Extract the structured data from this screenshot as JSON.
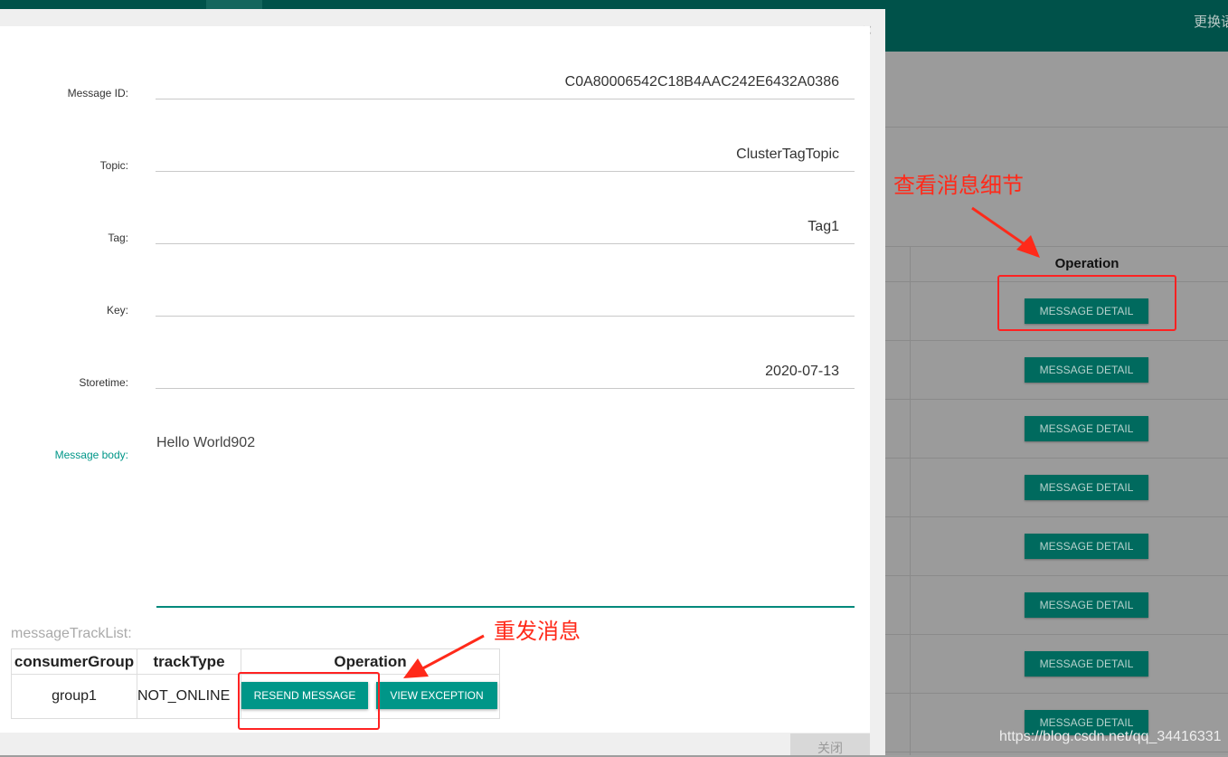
{
  "header": {
    "language_switch": "更换语"
  },
  "message": {
    "fields": [
      {
        "label": "Message ID:",
        "value": "C0A80006542C18B4AAC242E6432A0386"
      },
      {
        "label": "Topic:",
        "value": "ClusterTagTopic"
      },
      {
        "label": "Tag:",
        "value": "Tag1"
      },
      {
        "label": "Key:",
        "value": ""
      },
      {
        "label": "Storetime:",
        "value": "2020-07-13"
      }
    ],
    "body_label": "Message body:",
    "body": "Hello World902"
  },
  "track": {
    "title": "messageTrackList:",
    "columns": [
      "consumerGroup",
      "trackType",
      "Operation"
    ],
    "rows": [
      {
        "consumerGroup": "group1",
        "trackType": "NOT_ONLINE",
        "resend_label": "RESEND MESSAGE",
        "view_exception_label": "VIEW EXCEPTION"
      }
    ]
  },
  "modal": {
    "close_symbol": "×",
    "footer_close_label": "关闭"
  },
  "background_table": {
    "operation_header": "Operation",
    "detail_button_label": "MESSAGE DETAIL",
    "row_count": 8
  },
  "annotations": {
    "detail_note": "查看消息细节",
    "resend_note": "重发消息"
  },
  "watermark": "https://blog.csdn.net/qq_34416331",
  "colors": {
    "brand": "#00524a",
    "accent": "#009688",
    "annotation": "#ff2a1a"
  }
}
